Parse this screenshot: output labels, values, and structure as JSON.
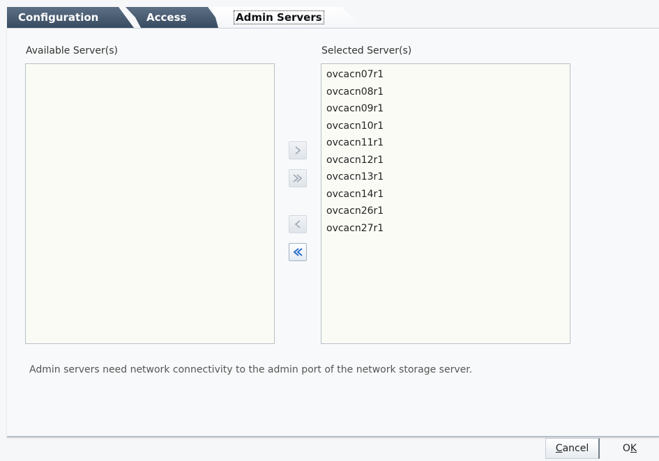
{
  "tabs": [
    {
      "label": "Configuration",
      "active": false
    },
    {
      "label": "Access",
      "active": false
    },
    {
      "label": "Admin Servers",
      "active": true
    }
  ],
  "available": {
    "label": "Available Server(s)",
    "items": []
  },
  "selected": {
    "label": "Selected Server(s)",
    "items": [
      "ovcacn07r1",
      "ovcacn08r1",
      "ovcacn09r1",
      "ovcacn10r1",
      "ovcacn11r1",
      "ovcacn12r1",
      "ovcacn13r1",
      "ovcacn14r1",
      "ovcacn26r1",
      "ovcacn27r1"
    ]
  },
  "shuttle": {
    "move": {
      "icon": "chevron-right-icon",
      "enabled": false
    },
    "move_all": {
      "icon": "double-chevron-right-icon",
      "enabled": false
    },
    "remove": {
      "icon": "chevron-left-icon",
      "enabled": false
    },
    "remove_all": {
      "icon": "double-chevron-left-icon",
      "enabled": true
    }
  },
  "note": "Admin servers need network connectivity to the admin port of the network storage server.",
  "footer": {
    "cancel_label": "Cancel",
    "ok_label": "OK"
  },
  "colors": {
    "tab_dark": "#384b60",
    "enabled_arrow": "#2a6fc9",
    "disabled_arrow": "#9aa6b2",
    "list_background": "#fbfbf6"
  }
}
